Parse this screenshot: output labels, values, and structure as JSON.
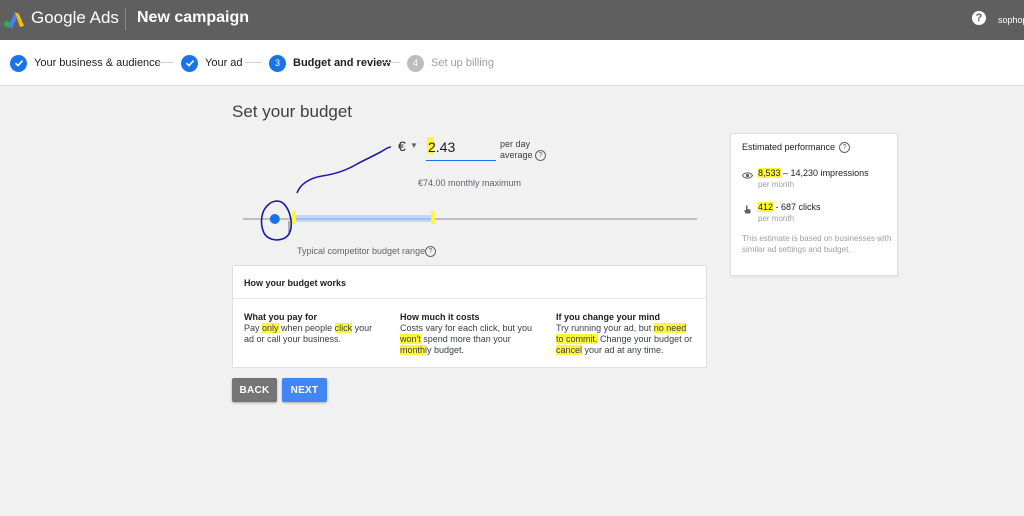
{
  "header": {
    "product": "Google Ads",
    "campaign_title": "New campaign",
    "help": "?",
    "user": "sophop"
  },
  "steps": [
    {
      "label": "Your business & audience",
      "state": "done"
    },
    {
      "label": "Your ad",
      "state": "done"
    },
    {
      "label": "Budget and review",
      "state": "current",
      "number": "3"
    },
    {
      "label": "Set up billing",
      "state": "pending",
      "number": "4"
    }
  ],
  "budget": {
    "title": "Set your budget",
    "currency": "€",
    "amount": "2.43",
    "per_day_line1": "per day",
    "per_day_line2": "average",
    "monthly_max": "€74.00 monthly maximum",
    "slider_value": 0.07,
    "competitor_label": "Typical competitor budget range"
  },
  "how": {
    "title": "How your budget works",
    "columns": [
      {
        "heading": "What you pay for",
        "pre": "Pay ",
        "hl1": "only",
        "mid": " when people ",
        "hl2": "click",
        "post": " your ad or call your business."
      },
      {
        "heading": "How much it costs",
        "pre": "Costs vary for each click, but you ",
        "hl1": "won't",
        "mid": " spend more than your ",
        "hl2": "month",
        "post": "ly budget."
      },
      {
        "heading": "If you change your mind",
        "pre": "Try running your ad, but ",
        "hl1": "no need to commit.",
        "mid": " Change your budget or ",
        "hl2": "cancel",
        "post": " your ad at any time."
      }
    ]
  },
  "buttons": {
    "back": "BACK",
    "next": "NEXT"
  },
  "performance": {
    "title": "Estimated performance",
    "impressions": {
      "low": "8,533",
      "rest": " – 14,230 impressions",
      "period": "per month"
    },
    "clicks": {
      "low": "412",
      "rest": " - 687 clicks",
      "period": "per month"
    },
    "note": "This estimate is based on businesses with similar ad settings and budget."
  },
  "colors": {
    "topbar": "#5f5f5f",
    "accent": "#1a73e8",
    "highlight": "#fff63b",
    "annotation_ink": "#1a1aa6"
  }
}
